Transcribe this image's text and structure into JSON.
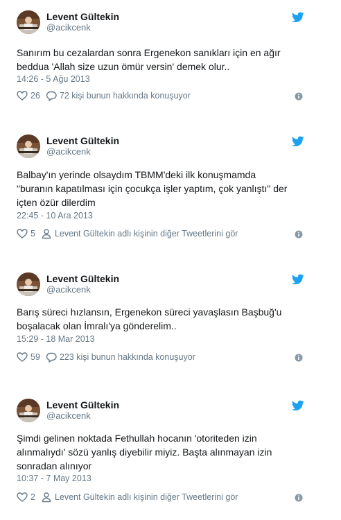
{
  "tweets": [
    {
      "name": "Levent Gültekin",
      "handle": "@acikcenk",
      "lines": [
        "Sanırım bu cezalardan sonra  Ergenekon sanıkları için en ağır",
        "beddua 'Allah size uzun ömür versin' demek olur.."
      ],
      "time": "14:26 - 5 Ağu 2013",
      "likes": "26",
      "action_text": "72 kişi bunun hakkında konuşuyor",
      "action_icon": "reply-bubble-icon"
    },
    {
      "name": "Levent Gültekin",
      "handle": "@acikcenk",
      "lines": [
        "Balbay'ın yerinde olsaydım TBMM'deki ilk konuşmamda",
        "\"buranın kapatılması için çocukça işler yaptım, çok yanlıştı\" der",
        "içten özür dilerdim"
      ],
      "time": "22:45 - 10 Ara 2013",
      "likes": "5",
      "action_text": "Levent Gültekin adlı kişinin diğer Tweetlerini gör",
      "action_icon": "person-icon"
    },
    {
      "name": "Levent Gültekin",
      "handle": "@acikcenk",
      "lines": [
        "Barış süreci hızlansın, Ergenekon süreci yavaşlasın Başbuğ'u",
        "boşalacak olan İmralı'ya gönderelim.."
      ],
      "time": "15:29 - 18 Mar 2013",
      "likes": "59",
      "action_text": "223 kişi bunun hakkında konuşuyor",
      "action_icon": "reply-bubble-icon"
    },
    {
      "name": "Levent Gültekin",
      "handle": "@acikcenk",
      "lines": [
        "Şimdi gelinen noktada Fethullah hocanın 'otoriteden izin",
        "alınmalıydı' sözü yanlış diyebilir miyiz. Başta alınmayan izin",
        "sonradan alınıyor"
      ],
      "time": "10:37 - 7 May 2013",
      "likes": "2",
      "action_text": "Levent Gültekin adlı kişinin diğer Tweetlerini gör",
      "action_icon": "person-icon"
    }
  ],
  "colors": {
    "bird": "#1da1f2",
    "meta": "#657786",
    "text": "#14171a",
    "info": "#8899a6"
  }
}
